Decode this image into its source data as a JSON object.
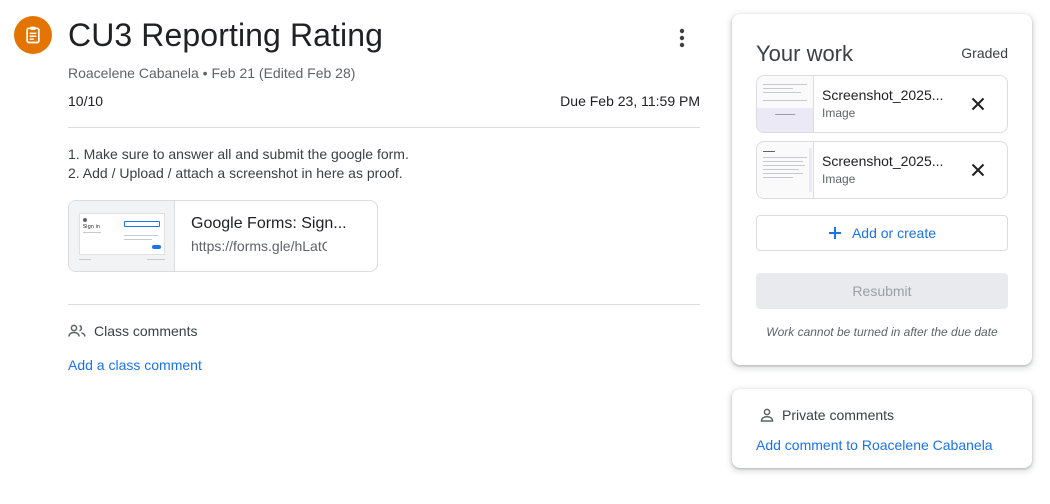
{
  "assignment": {
    "icon": "assignment-icon",
    "icon_color": "#e37400",
    "title": "CU3 Reporting Rating",
    "meta": "Roacelene Cabanela • Feb 21 (Edited Feb 28)",
    "points_earned": "10",
    "points_total": "/10",
    "due": "Due Feb 23, 11:59 PM",
    "instructions": [
      "1. Make sure to answer all and submit the google form.",
      "2. Add / Upload / attach a screenshot in here as proof."
    ],
    "attachment": {
      "title": "Google Forms: Sign...",
      "url": "https://forms.gle/hLatQTg"
    }
  },
  "class_comments": {
    "heading": "Class comments",
    "add_label": "Add a class comment"
  },
  "your_work": {
    "title": "Your work",
    "status": "Graded",
    "files": [
      {
        "name": "Screenshot_2025...",
        "type": "Image"
      },
      {
        "name": "Screenshot_2025...",
        "type": "Image"
      }
    ],
    "add_create_label": "Add or create",
    "resubmit_label": "Resubmit",
    "note": "Work cannot be turned in after the due date"
  },
  "private_comments": {
    "heading": "Private comments",
    "add_label": "Add comment to Roacelene Cabanela"
  },
  "colors": {
    "accent": "#1a73e8",
    "icon_orange": "#e37400",
    "disabled_bg": "#e8eaed"
  }
}
